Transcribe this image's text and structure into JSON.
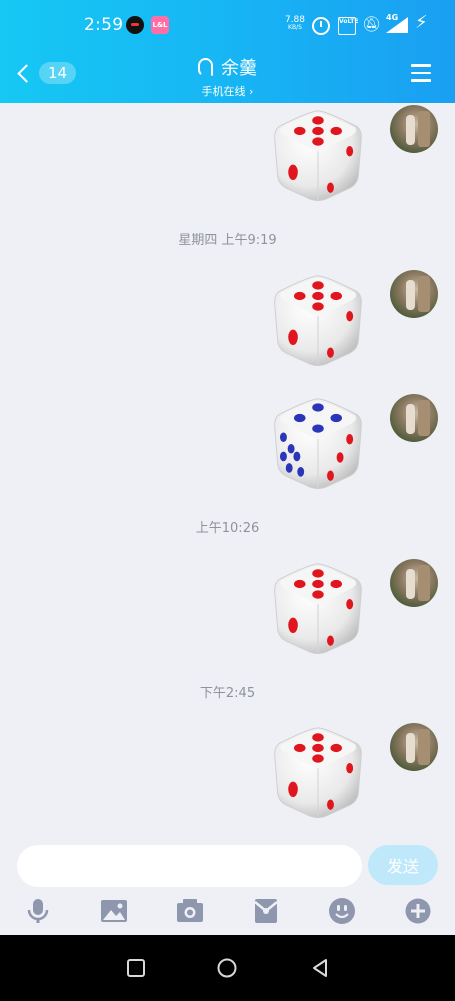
{
  "status_bar": {
    "time": "2:59",
    "app2_label": "L&L",
    "speed_value": "7.88",
    "speed_unit": "KB/S",
    "volte": "VoLTE",
    "network": "4G"
  },
  "header": {
    "back_count": "14",
    "contact_name": "余羹",
    "status_text": "手机在线 ›"
  },
  "chat": {
    "timestamps": [
      "星期四 上午9:19",
      "上午10:26",
      "下午2:45"
    ],
    "messages": [
      {
        "type": "dice",
        "face": 5,
        "color": "red"
      },
      {
        "type": "dice",
        "face": 5,
        "color": "red"
      },
      {
        "type": "dice",
        "face": 4,
        "color": "blue"
      },
      {
        "type": "dice",
        "face": 5,
        "color": "red"
      },
      {
        "type": "dice",
        "face": 5,
        "color": "red"
      }
    ]
  },
  "input": {
    "placeholder": "",
    "value": "",
    "send_label": "发送"
  },
  "toolbar": [
    "voice-icon",
    "image-icon",
    "camera-icon",
    "red-packet-icon",
    "emoji-icon",
    "plus-icon"
  ],
  "colors": {
    "header_start": "#16c8f3",
    "header_end": "#1a9ff2",
    "background": "#eef0f5",
    "send_disabled": "#bfe8fb",
    "icon_gray": "#8e97ad",
    "pip_red": "#e0161e",
    "pip_blue": "#2a35b8"
  }
}
